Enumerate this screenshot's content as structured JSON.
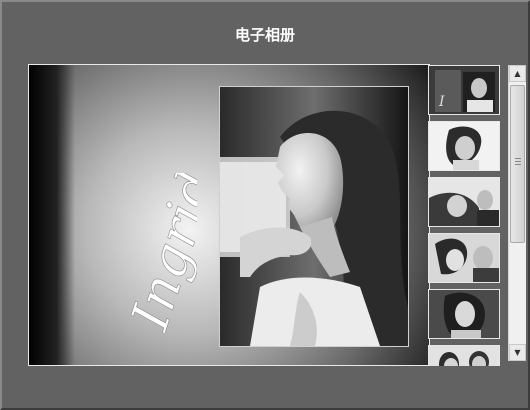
{
  "window": {
    "title": "电子相册"
  },
  "main_view": {
    "signature_text": "Ingrid",
    "photo_label": "portrait-photo"
  },
  "thumbnails": [
    {
      "label": "thumb-1",
      "selected": true
    },
    {
      "label": "thumb-2",
      "selected": false
    },
    {
      "label": "thumb-3",
      "selected": false
    },
    {
      "label": "thumb-4",
      "selected": false
    },
    {
      "label": "thumb-5",
      "selected": false
    },
    {
      "label": "thumb-6",
      "selected": false
    }
  ],
  "scrollbar": {
    "up_icon": "triangle-up-icon",
    "down_icon": "triangle-down-icon",
    "grip_icon": "grip-icon"
  }
}
